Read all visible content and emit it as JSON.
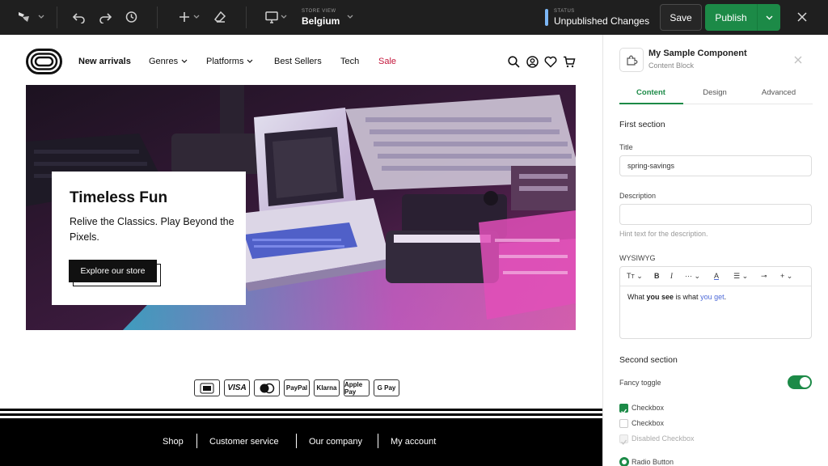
{
  "topbar": {
    "store_view_label": "STORE VIEW",
    "store_view_value": "Belgium",
    "status_label": "STATUS",
    "status_value": "Unpublished Changes",
    "save_label": "Save",
    "publish_label": "Publish",
    "icons": [
      "logo-icon",
      "undo-icon",
      "redo-icon",
      "history-icon",
      "add-icon",
      "eraser-icon",
      "desktop-icon",
      "close-icon"
    ]
  },
  "store": {
    "nav": {
      "links": [
        "New arrivals",
        "Genres",
        "Platforms",
        "Best Sellers",
        "Tech",
        "Sale"
      ],
      "sale_color": "#c4163b"
    },
    "hero": {
      "title": "Timeless Fun",
      "subtitle": "Relive the Classics. Play Beyond the Pixels.",
      "cta": "Explore our store"
    },
    "payments": [
      "iDEAL",
      "VISA",
      "Mastercard",
      "PayPal",
      "Klarna",
      "Apple Pay",
      "G Pay"
    ],
    "footer_links": [
      "Shop",
      "Customer service",
      "Our company",
      "My account"
    ]
  },
  "panel": {
    "component_title": "My Sample Component",
    "component_subtitle": "Content Block",
    "tabs": [
      "Content",
      "Design",
      "Advanced"
    ],
    "active_tab": "Content",
    "first_section": "First section",
    "title_label": "Title",
    "title_value": "spring-savings",
    "description_label": "Description",
    "description_value": "",
    "description_hint": "Hint text for the description.",
    "wysiwyg_label": "WYSIWYG",
    "wysiwyg_text": {
      "part1": "What ",
      "bold": "you see",
      "part2": " is what ",
      "link": "you get",
      "part3": "."
    },
    "second_section": "Second section",
    "fancy_toggle_label": "Fancy toggle",
    "fancy_toggle_on": true,
    "checkboxes": [
      {
        "label": "Checkbox",
        "checked": true,
        "disabled": false
      },
      {
        "label": "Checkbox",
        "checked": false,
        "disabled": false
      },
      {
        "label": "Disabled Checkbox",
        "checked": true,
        "disabled": true
      }
    ],
    "radio_label": "Radio Button",
    "accent_color": "#1c8a47"
  }
}
